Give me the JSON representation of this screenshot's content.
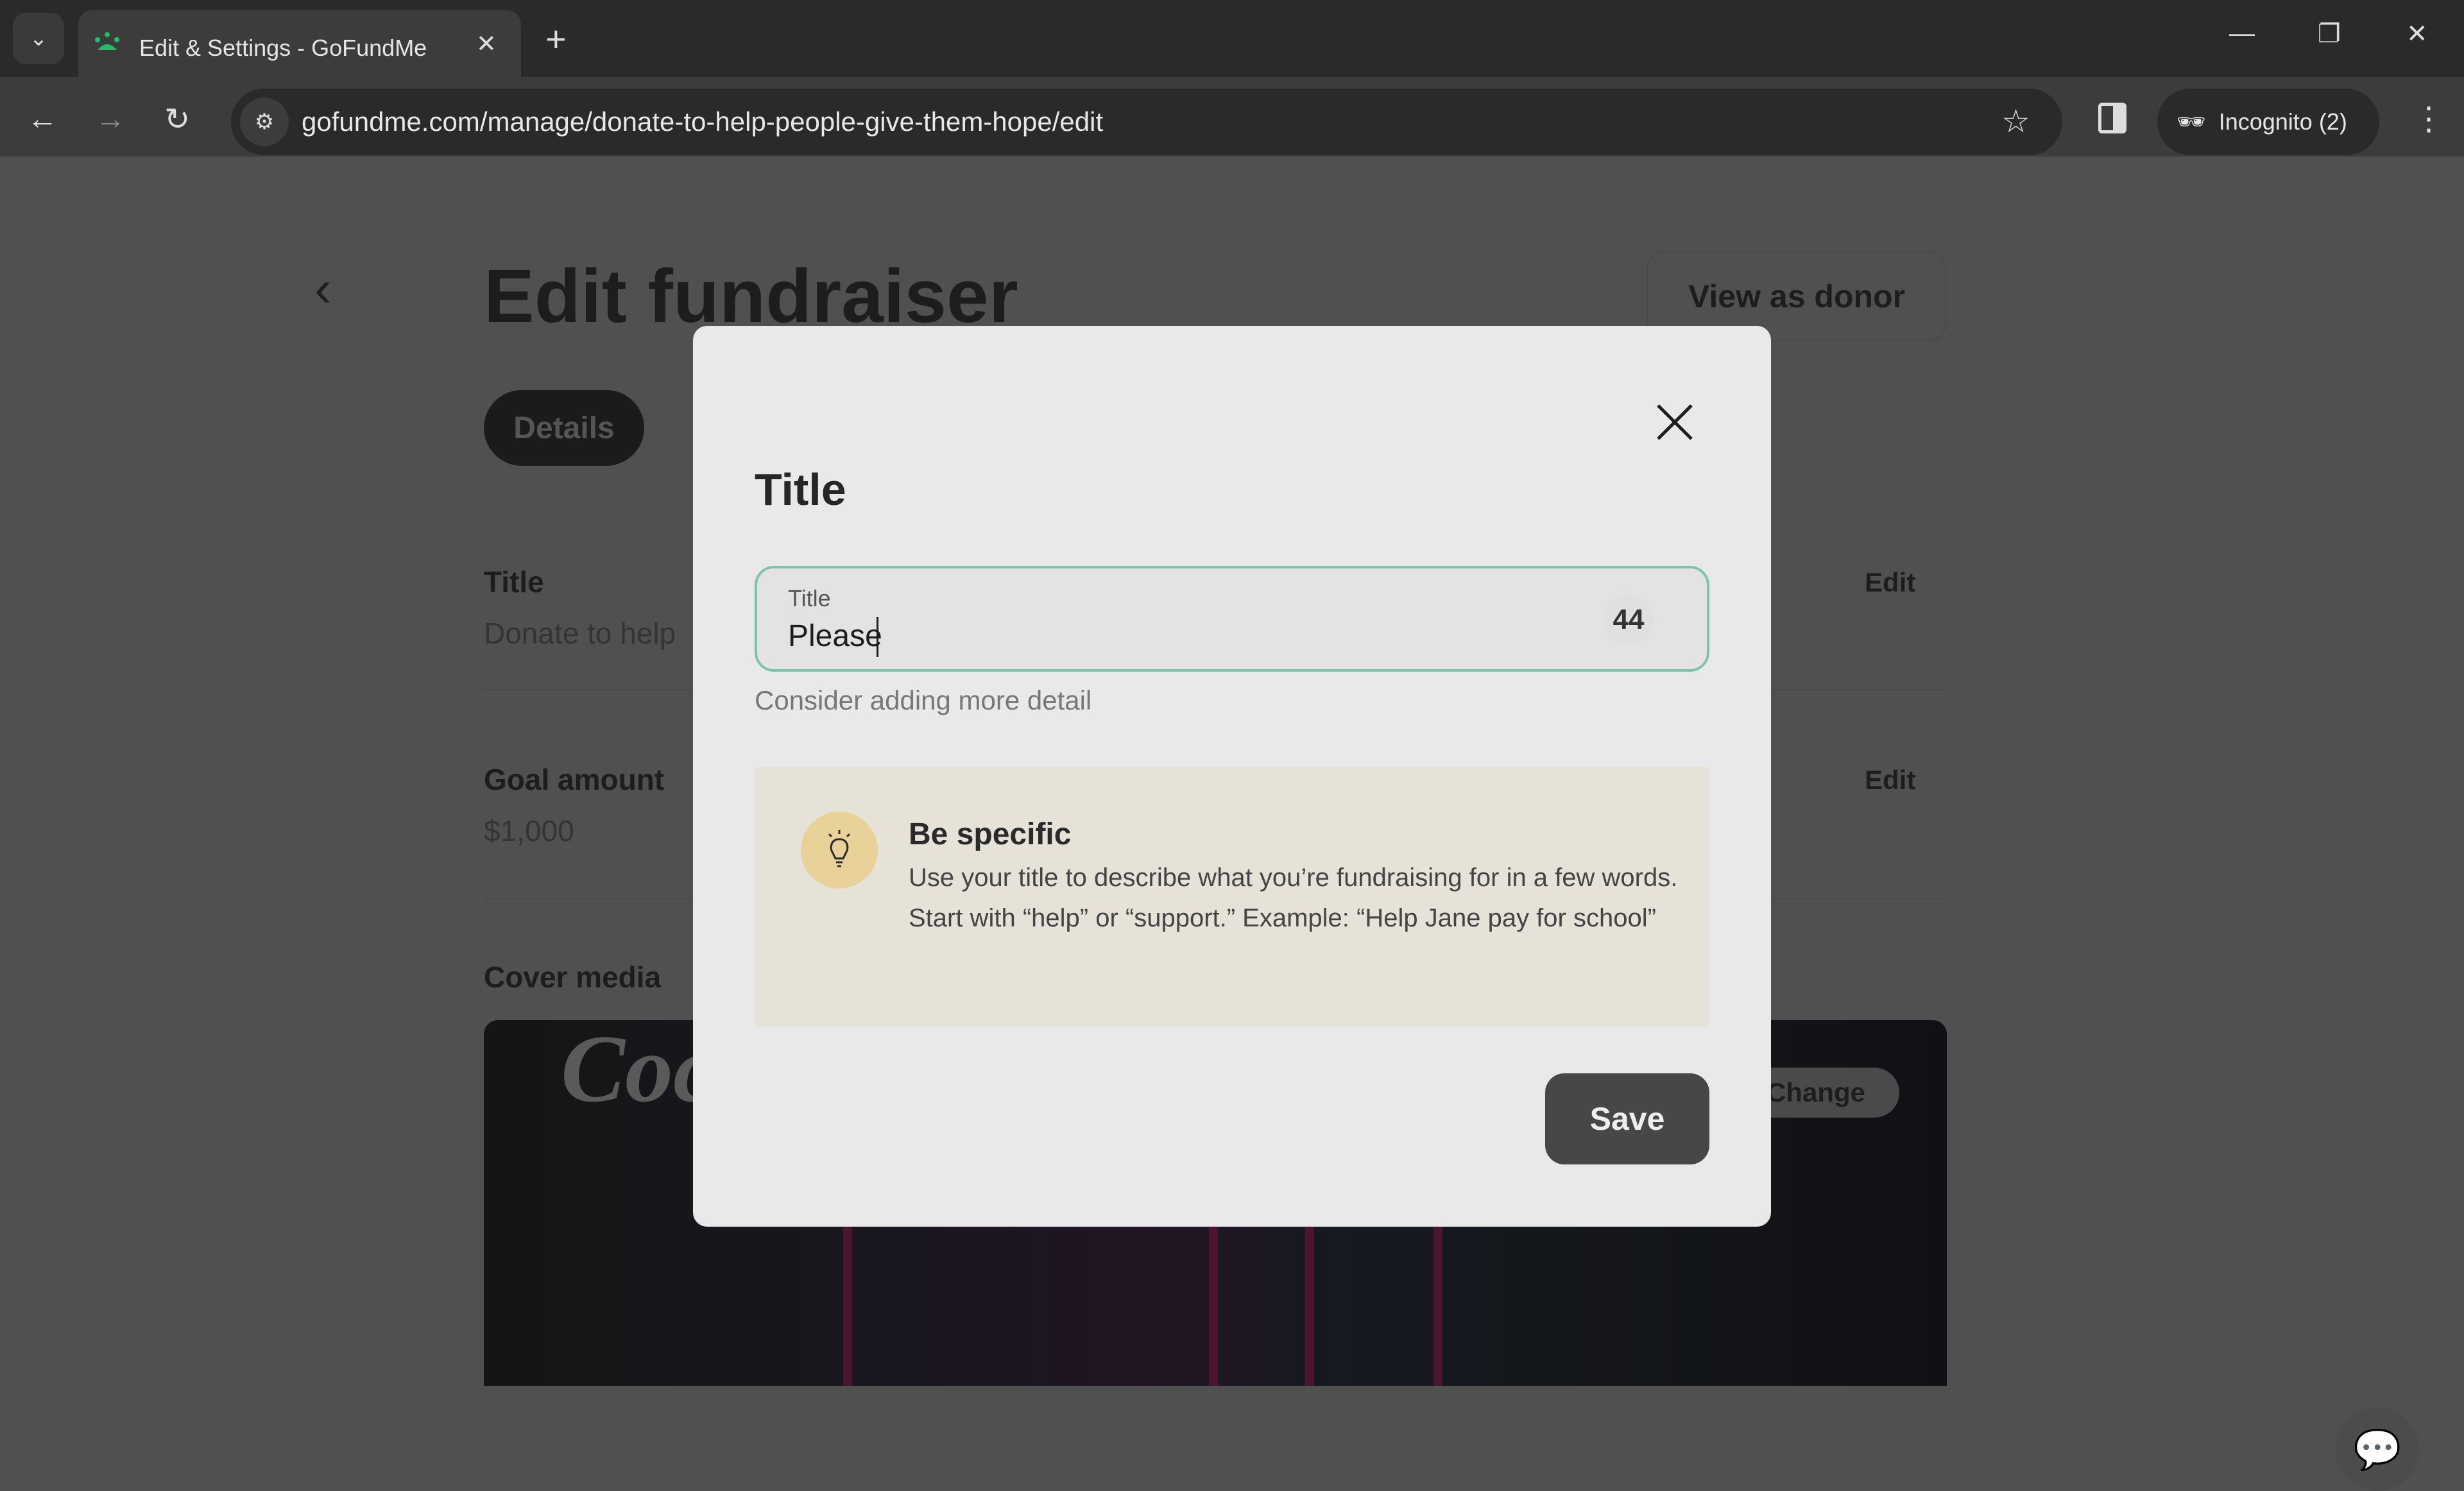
{
  "browser": {
    "tab_title": "Edit & Settings - GoFundMe",
    "url": "gofundme.com/manage/donate-to-help-people-give-them-hope/edit",
    "incognito_label": "Incognito (2)",
    "favicon_color": "#1fbf6a"
  },
  "page": {
    "heading": "Edit fundraiser",
    "view_as_donor": "View as donor",
    "active_tab": "Details",
    "sections": [
      {
        "label": "Title",
        "value": "Donate to help",
        "action": "Edit"
      },
      {
        "label": "Goal amount",
        "value": "$1,000",
        "action": "Edit"
      },
      {
        "label": "Cover media",
        "action": "Change"
      }
    ]
  },
  "modal": {
    "title": "Title",
    "field_label": "Title",
    "field_value": "Please",
    "char_count": "44",
    "hint": "Consider adding more detail",
    "tip_heading": "Be specific",
    "tip_body": "Use your title to describe what you’re fundraising for in a few words. Start with “help” or “support.” Example: “Help Jane pay for school”",
    "save_label": "Save",
    "accent_color": "#7fc4a6"
  }
}
